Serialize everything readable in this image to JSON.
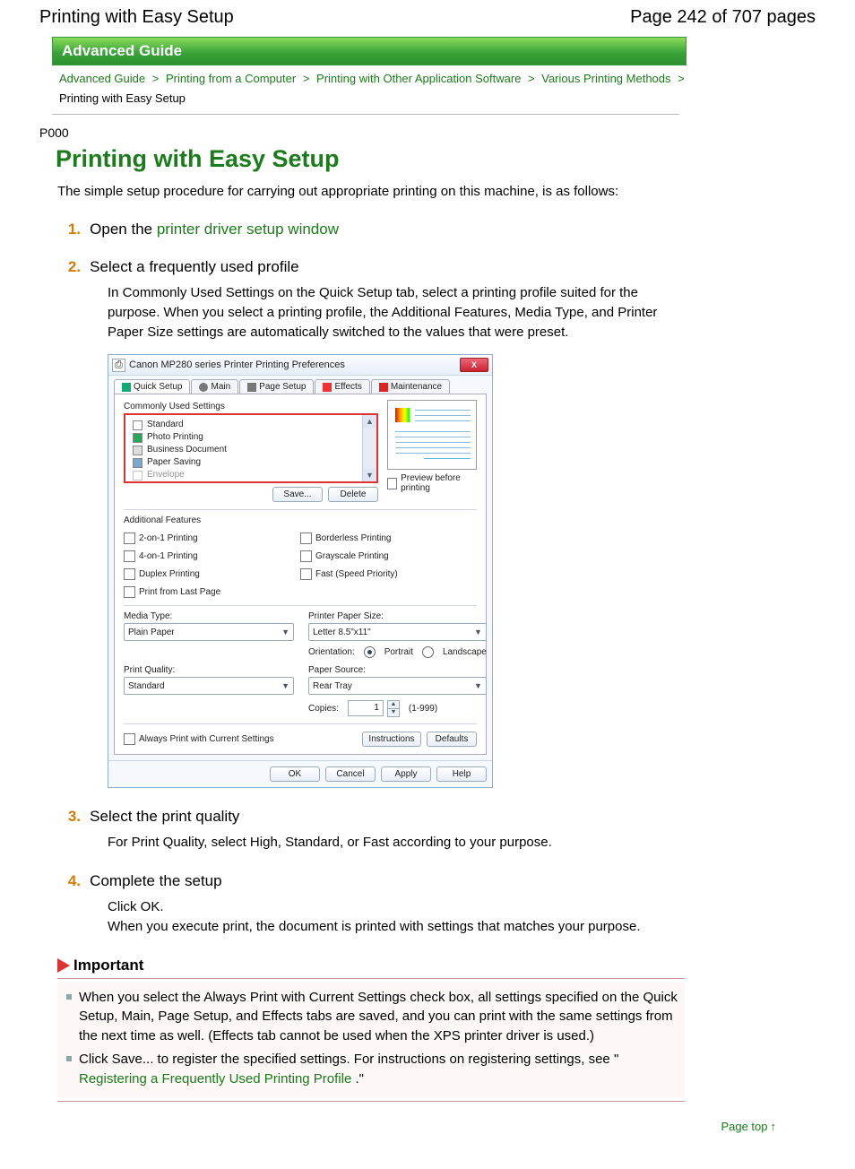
{
  "header": {
    "title": "Printing with Easy Setup",
    "page_indicator": "Page 242 of 707 pages"
  },
  "banner": "Advanced Guide",
  "breadcrumbs": {
    "items": [
      "Advanced Guide",
      "Printing from a Computer",
      "Printing with Other Application Software",
      "Various Printing Methods"
    ],
    "current": "Printing with Easy Setup",
    "sep": ">"
  },
  "doc_code": "P000",
  "title": "Printing with Easy Setup",
  "intro": "The simple setup procedure for carrying out appropriate printing on this machine, is as follows:",
  "steps": [
    {
      "n": "1.",
      "prefix": "Open the ",
      "link": "printer driver setup window",
      "body": ""
    },
    {
      "n": "2.",
      "title": "Select a frequently used profile",
      "body": "In Commonly Used Settings on the Quick Setup tab, select a printing profile suited for the purpose. When you select a printing profile, the Additional Features, Media Type, and Printer Paper Size settings are automatically switched to the values that were preset."
    },
    {
      "n": "3.",
      "title": "Select the print quality",
      "body": "For Print Quality, select High, Standard, or Fast according to your purpose."
    },
    {
      "n": "4.",
      "title": "Complete the setup",
      "body": "Click OK.\nWhen you execute print, the document is printed with settings that matches your purpose."
    }
  ],
  "dialog": {
    "title": "Canon MP280 series Printer Printing Preferences",
    "close": "X",
    "tabs": [
      "Quick Setup",
      "Main",
      "Page Setup",
      "Effects",
      "Maintenance"
    ],
    "commonly_label": "Commonly Used Settings",
    "profiles": [
      "Standard",
      "Photo Printing",
      "Business Document",
      "Paper Saving",
      "Envelope"
    ],
    "save": "Save...",
    "delete": "Delete",
    "preview_label": "Preview before printing",
    "addl_label": "Additional Features",
    "features_left": [
      "2-on-1 Printing",
      "4-on-1 Printing",
      "Duplex Printing",
      "Print from Last Page"
    ],
    "features_right": [
      "Borderless Printing",
      "Grayscale Printing",
      "Fast (Speed Priority)"
    ],
    "media_label": "Media Type:",
    "media_value": "Plain Paper",
    "quality_label": "Print Quality:",
    "quality_value": "Standard",
    "size_label": "Printer Paper Size:",
    "size_value": "Letter 8.5\"x11\"",
    "orient_label": "Orientation:",
    "orient_port": "Portrait",
    "orient_land": "Landscape",
    "source_label": "Paper Source:",
    "source_value": "Rear Tray",
    "copies_label": "Copies:",
    "copies_value": "1",
    "copies_range": "(1-999)",
    "always_label": "Always Print with Current Settings",
    "instructions": "Instructions",
    "defaults": "Defaults",
    "ok": "OK",
    "cancel": "Cancel",
    "apply": "Apply",
    "help": "Help"
  },
  "important": {
    "heading": "Important",
    "items": [
      {
        "text": "When you select the Always Print with Current Settings check box, all settings specified on the Quick Setup, Main, Page Setup, and Effects tabs are saved, and you can print with the same settings from the next time as well. (Effects tab cannot be used when the XPS printer driver is used.)"
      },
      {
        "text_before": "Click Save... to register the specified settings. For instructions on registering settings, see \"",
        "link": "Registering a Frequently Used Printing Profile",
        "text_after": ".\""
      }
    ]
  },
  "page_top": "Page top"
}
